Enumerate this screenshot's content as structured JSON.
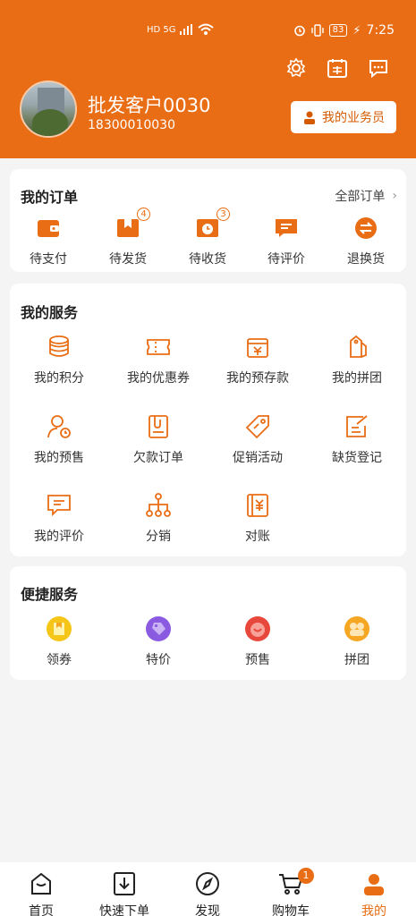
{
  "status_bar": {
    "network": "HD 5G",
    "battery": "83",
    "time": "7:25"
  },
  "header": {
    "username": "批发客户0030",
    "phone": "18300010030",
    "agent_button": "我的业务员",
    "icons": [
      "settings-icon",
      "sign-in-icon",
      "message-icon"
    ]
  },
  "orders": {
    "title": "我的订单",
    "all_link": "全部订单",
    "items": [
      {
        "label": "待支付",
        "icon": "wallet-icon",
        "badge": ""
      },
      {
        "label": "待发货",
        "icon": "package-icon",
        "badge": "4"
      },
      {
        "label": "待收货",
        "icon": "delivery-icon",
        "badge": "3"
      },
      {
        "label": "待评价",
        "icon": "comment-icon",
        "badge": ""
      },
      {
        "label": "退换货",
        "icon": "exchange-icon",
        "badge": ""
      }
    ]
  },
  "services": {
    "title": "我的服务",
    "items": [
      {
        "label": "我的积分",
        "icon": "coins-icon"
      },
      {
        "label": "我的优惠券",
        "icon": "coupon-icon"
      },
      {
        "label": "我的预存款",
        "icon": "deposit-icon"
      },
      {
        "label": "我的拼团",
        "icon": "group-tag-icon"
      },
      {
        "label": "我的预售",
        "icon": "presale-user-icon"
      },
      {
        "label": "欠款订单",
        "icon": "debt-order-icon"
      },
      {
        "label": "促销活动",
        "icon": "promo-tag-icon"
      },
      {
        "label": "缺货登记",
        "icon": "register-icon"
      },
      {
        "label": "我的评价",
        "icon": "review-icon"
      },
      {
        "label": "分销",
        "icon": "distribution-icon"
      },
      {
        "label": "对账",
        "icon": "statement-icon"
      }
    ]
  },
  "quick": {
    "title": "便捷服务",
    "items": [
      {
        "label": "领券",
        "icon": "get-coupon-icon",
        "color": "#f5c518"
      },
      {
        "label": "特价",
        "icon": "special-price-icon",
        "color": "#8a5be0"
      },
      {
        "label": "预售",
        "icon": "presale-icon",
        "color": "#e8473b"
      },
      {
        "label": "拼团",
        "icon": "group-buy-icon",
        "color": "#f5a623"
      }
    ]
  },
  "tabbar": {
    "items": [
      {
        "label": "首页",
        "icon": "home-icon",
        "active": false
      },
      {
        "label": "快速下单",
        "icon": "quick-order-icon",
        "active": false
      },
      {
        "label": "发现",
        "icon": "compass-icon",
        "active": false
      },
      {
        "label": "购物车",
        "icon": "cart-icon",
        "active": false,
        "badge": "1"
      },
      {
        "label": "我的",
        "icon": "profile-icon",
        "active": true
      }
    ]
  },
  "colors": {
    "brand": "#e96d14",
    "background": "#f4f4f4"
  }
}
